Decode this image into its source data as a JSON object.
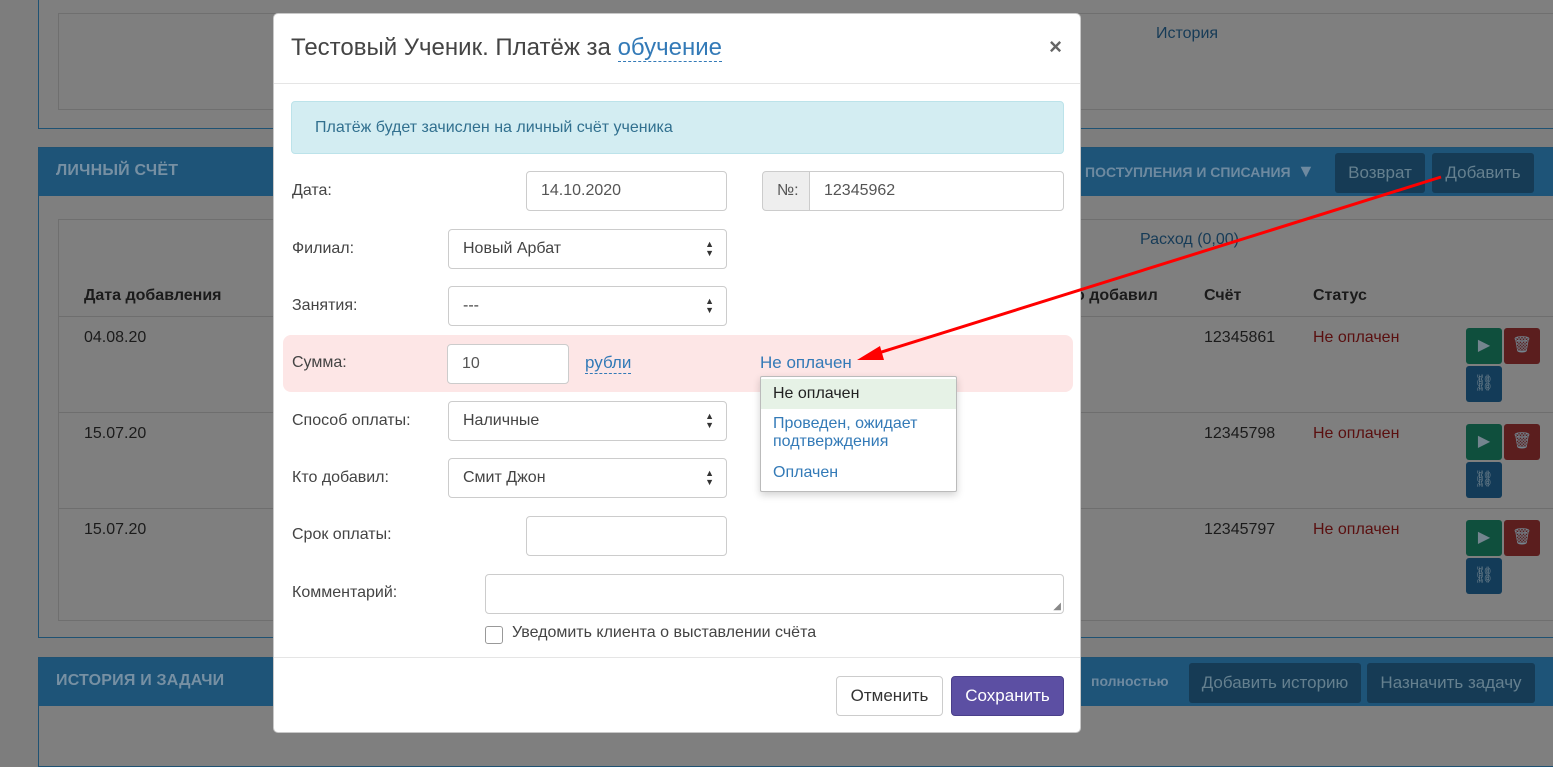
{
  "background": {
    "top_panel": {
      "history_link": "История"
    },
    "account_panel": {
      "title": "ЛИЧНЫЙ СЧЁТ",
      "filter_label": "ПОСТУПЛЕНИЯ И СПИСАНИЯ",
      "refund_button": "Возврат",
      "add_button": "Добавить",
      "expense_link": "Расход (0,00)",
      "columns": {
        "date_added": "Дата добавления",
        "who_added": "о добавил",
        "account": "Счёт",
        "status": "Статус"
      },
      "rows": [
        {
          "date": "04.08.20",
          "account": "12345861",
          "status": "Не оплачен"
        },
        {
          "date": "15.07.20",
          "account": "12345798",
          "status": "Не оплачен"
        },
        {
          "date": "15.07.20",
          "account": "12345797",
          "status": "Не оплачен"
        }
      ]
    },
    "history_panel": {
      "title": "ИСТОРИЯ И ЗАДАЧИ",
      "full_label": "полностью",
      "add_history_button": "Добавить историю",
      "assign_task_button": "Назначить задачу"
    }
  },
  "modal": {
    "title_prefix": "Тестовый Ученик. Платёж за",
    "title_link": "обучение",
    "close_symbol": "×",
    "alert_text": "Платёж будет зачислен на личный счёт ученика",
    "date_label": "Дата:",
    "date_value": "14.10.2020",
    "number_prefix": "№:",
    "number_value": "12345962",
    "branch_label": "Филиал:",
    "branch_value": "Новый Арбат",
    "lessons_label": "Занятия:",
    "lessons_value": "---",
    "sum_label": "Сумма:",
    "sum_value": "10",
    "currency_link": "рубли",
    "status_link": "Не оплачен",
    "status_options": [
      "Не оплачен",
      "Проведен, ожидает подтверждения",
      "Оплачен"
    ],
    "status_option_2_line1": "Проведен, ожидает",
    "status_option_2_line2": "подтверждения",
    "payment_method_label": "Способ оплаты:",
    "payment_method_value": "Наличные",
    "added_by_label": "Кто добавил:",
    "added_by_value": "Смит Джон",
    "due_date_label": "Срок оплаты:",
    "due_date_value": "",
    "comment_label": "Комментарий:",
    "notify_label": "Уведомить клиента о выставлении счёта",
    "cancel_button": "Отменить",
    "save_button": "Сохранить"
  },
  "colors": {
    "accent": "#337ab7",
    "save_button": "#5c4fa3",
    "alert_bg": "#d3edf2",
    "sum_row_bg": "#fde6e6",
    "annotation_arrow": "#ff0000"
  },
  "icons": [
    "close-icon",
    "filter-icon",
    "export-icon",
    "trash-icon",
    "link-icon",
    "select-arrows-icon",
    "resize-grip-icon"
  ]
}
